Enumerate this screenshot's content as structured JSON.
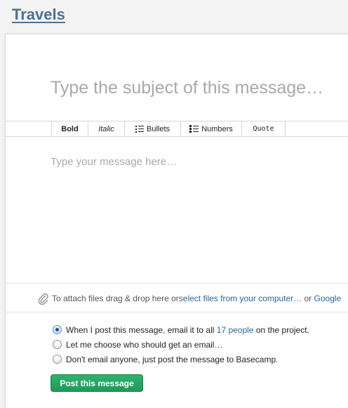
{
  "project": {
    "title": "Travels"
  },
  "composer": {
    "subject_placeholder": "Type the subject of this message…",
    "body_placeholder": "Type your message here…"
  },
  "toolbar": {
    "bold": "Bold",
    "italic": "Italic",
    "bullets": "Bullets",
    "numbers": "Numbers",
    "quote": "Quote"
  },
  "attach": {
    "prefix": "To attach files drag & drop here or ",
    "select_link": "select files from your computer…",
    "or": " or ",
    "google_link": "Google"
  },
  "notify": {
    "option1_prefix": "When I post this message, email it to all ",
    "option1_link": "17 people",
    "option1_suffix": " on the project.",
    "option2": "Let me choose who should get an email…",
    "option3": "Don't email anyone, just post the message to Basecamp."
  },
  "submit": {
    "label": "Post this message"
  },
  "colors": {
    "link": "#2a6496",
    "project_title": "#4a7196",
    "submit_button": "#22a561",
    "placeholder": "#a9a9a9"
  }
}
